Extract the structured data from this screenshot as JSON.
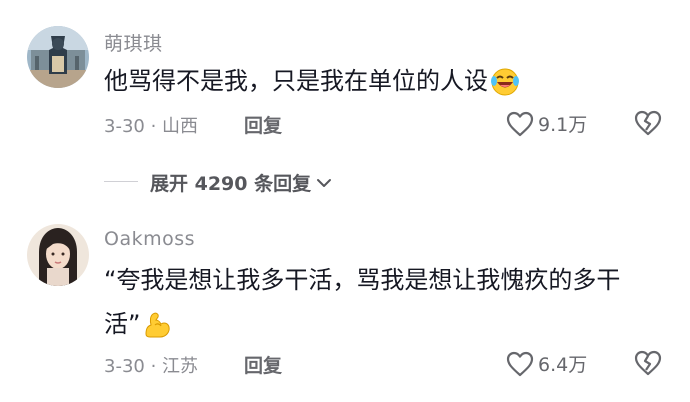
{
  "comments": [
    {
      "username": "萌琪琪",
      "text": "他骂得不是我，只是我在单位的人设",
      "emoji": "laughing-crying-emoji",
      "date_location": "3-30 · 山西",
      "reply_label": "回复",
      "likes": "9.1万"
    },
    {
      "username": "Oakmoss",
      "text_line1": "“夸我是想让我多干活，骂我是想让我愧疚的多干",
      "text_line2": "活”",
      "emoji": "flexed-biceps-emoji",
      "date_location": "3-30 · 江苏",
      "reply_label": "回复",
      "likes": "6.4万"
    }
  ],
  "expand_replies": {
    "label": "展开 4290 条回复"
  },
  "colors": {
    "text_primary": "#161823",
    "text_secondary": "#8a8b91",
    "background": "#ffffff"
  }
}
